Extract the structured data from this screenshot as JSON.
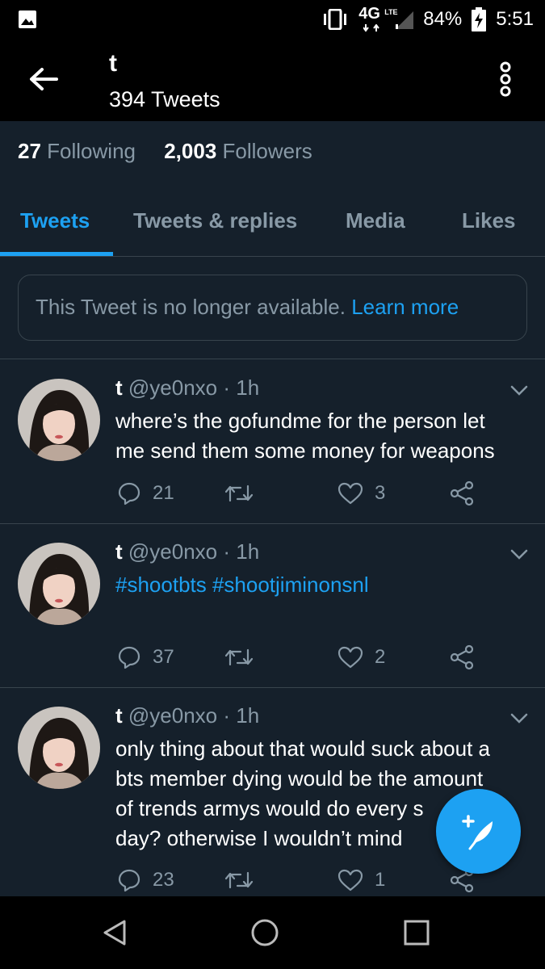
{
  "status_bar": {
    "network": "4G",
    "network_sub": "LTE",
    "battery": "84%",
    "time": "5:51",
    "icons": [
      "gallery-icon",
      "vibrate-icon",
      "signal-icon",
      "battery-charging-icon"
    ]
  },
  "header": {
    "title": "t",
    "tweet_count": "394 Tweets"
  },
  "profile": {
    "following_count": "27",
    "following_label": "Following",
    "followers_count": "2,003",
    "followers_label": "Followers"
  },
  "tabs": [
    {
      "label": "Tweets",
      "active": true
    },
    {
      "label": "Tweets & replies",
      "active": false
    },
    {
      "label": "Media",
      "active": false
    },
    {
      "label": "Likes",
      "active": false
    }
  ],
  "notice": {
    "text": "This Tweet is no longer available.",
    "link": "Learn more"
  },
  "tweets": [
    {
      "name": "t",
      "handle": "@ye0nxo",
      "time": "1h",
      "text_lines": [
        "where’s the gofundme for the person let",
        "me send them some money for weapons"
      ],
      "replies": "21",
      "retweets": "",
      "likes": "3"
    },
    {
      "name": "t",
      "handle": "@ye0nxo",
      "time": "1h",
      "text_lines": [
        "#shootbts #shootjiminonsnl"
      ],
      "replies": "37",
      "retweets": "",
      "likes": "2"
    },
    {
      "name": "t",
      "handle": "@ye0nxo",
      "time": "1h",
      "text_lines": [
        "only thing about that would suck about a",
        "bts member dying would be the amount",
        "of trends armys would do every s",
        "day? otherwise I wouldn’t mind"
      ],
      "replies": "23",
      "retweets": "",
      "likes": "1"
    }
  ],
  "colors": {
    "background": "#15202b",
    "accent": "#1da1f2",
    "muted": "#8899a6",
    "divider": "#38444d"
  }
}
